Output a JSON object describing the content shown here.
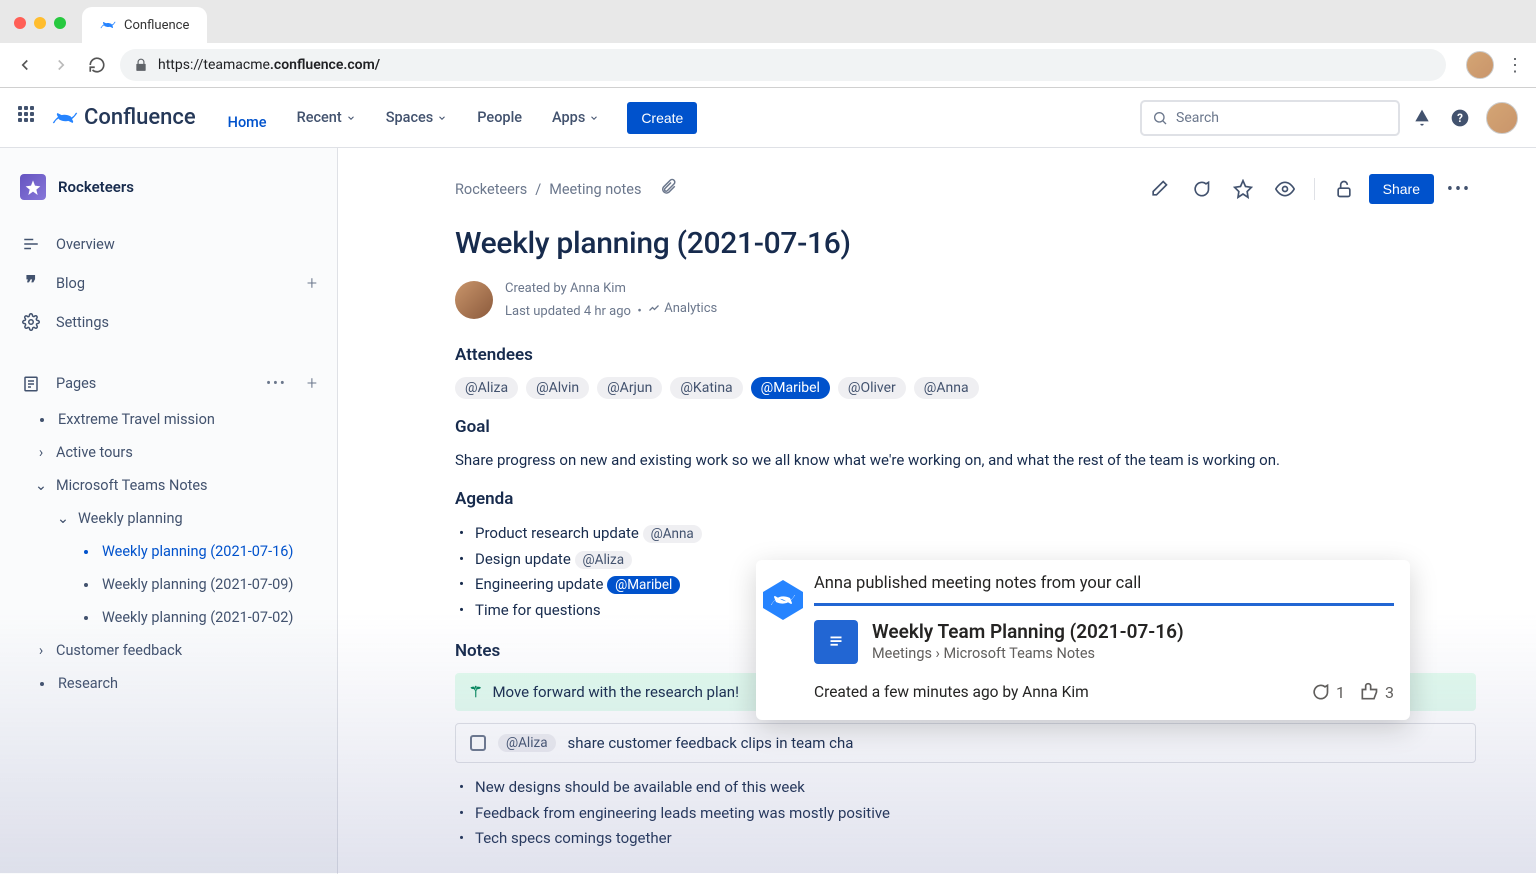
{
  "browser": {
    "tab_title": "Confluence",
    "url_prefix": "https://teamacme",
    "url_bold": ".confluence.com/"
  },
  "header": {
    "product": "Confluence",
    "nav": {
      "home": "Home",
      "recent": "Recent",
      "spaces": "Spaces",
      "people": "People",
      "apps": "Apps"
    },
    "create": "Create",
    "search_placeholder": "Search"
  },
  "sidebar": {
    "space": "Rocketeers",
    "items": {
      "overview": "Overview",
      "blog": "Blog",
      "settings": "Settings",
      "pages": "Pages"
    },
    "tree": {
      "mission": "Exxtreme Travel mission",
      "active_tours": "Active tours",
      "teams_notes": "Microsoft Teams Notes",
      "weekly_planning": "Weekly planning",
      "wp1": "Weekly planning (2021-07-16)",
      "wp2": "Weekly planning (2021-07-09)",
      "wp3": "Weekly planning (2021-07-02)",
      "customer_feedback": "Customer feedback",
      "research": "Research"
    }
  },
  "page": {
    "crumb_space": "Rocketeers",
    "crumb_parent": "Meeting notes",
    "title": "Weekly planning (2021-07-16)",
    "created_by": "Created by Anna Kim",
    "updated": "Last updated 4 hr ago",
    "analytics": "Analytics",
    "share": "Share",
    "sections": {
      "attendees": "Attendees",
      "goal": "Goal",
      "agenda": "Agenda",
      "notes": "Notes"
    },
    "attendees": [
      "@Aliza",
      "@Alvin",
      "@Arjun",
      "@Katina",
      "@Maribel",
      "@Oliver",
      "@Anna"
    ],
    "attendees_highlight_index": 4,
    "goal_text": "Share progress on new and existing work so we all know what we're working on, and what the rest of the team is working on.",
    "agenda": [
      {
        "text": "Product research update",
        "mention": "@Anna",
        "hl": false
      },
      {
        "text": "Design update",
        "mention": "@Aliza",
        "hl": false
      },
      {
        "text": "Engineering update",
        "mention": "@Maribel",
        "hl": true
      },
      {
        "text": "Time for questions",
        "mention": null,
        "hl": false
      }
    ],
    "note_banner": "Move forward with the research plan!",
    "task": {
      "mention": "@Aliza",
      "text": "share customer feedback clips in team cha"
    },
    "notes_bullets": [
      "New designs should be available end of this week",
      "Feedback from engineering leads meeting was mostly positive",
      "Tech specs comings together"
    ]
  },
  "popup": {
    "line1": "Anna published meeting notes from your call",
    "doc_title": "Weekly Team Planning (2021-07-16)",
    "doc_crumb": "Meetings › Microsoft Teams Notes",
    "meta": "Created a few minutes ago by Anna Kim",
    "comments": "1",
    "likes": "3"
  }
}
